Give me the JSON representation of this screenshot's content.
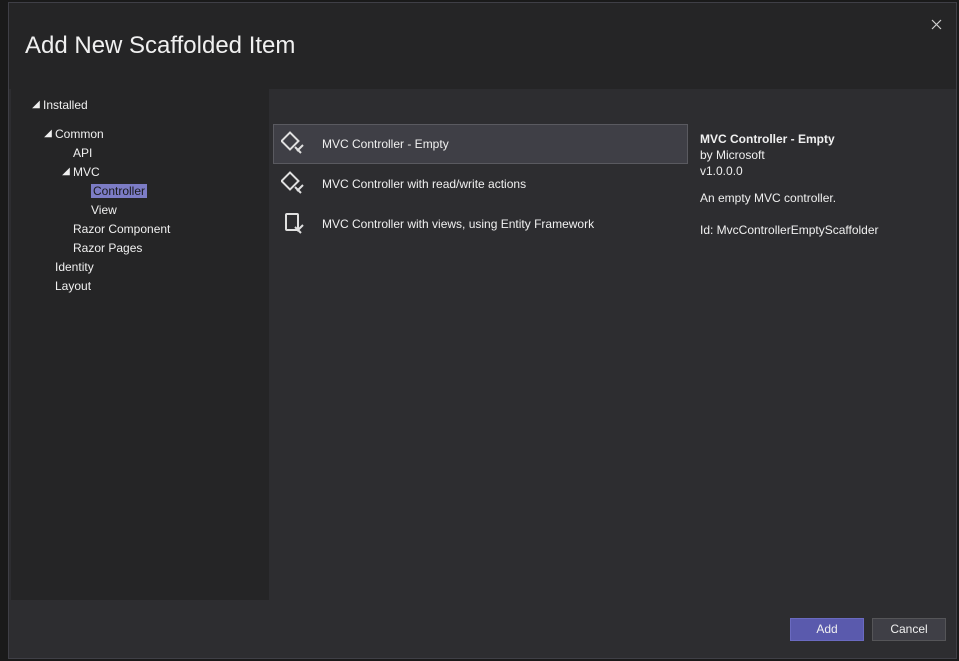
{
  "dialog": {
    "title": "Add New Scaffolded Item"
  },
  "tree": {
    "installed": "Installed",
    "common": "Common",
    "api": "API",
    "mvc": "MVC",
    "controller": "Controller",
    "view": "View",
    "razor_component": "Razor Component",
    "razor_pages": "Razor Pages",
    "identity": "Identity",
    "layout": "Layout"
  },
  "list": {
    "item0": "MVC Controller - Empty",
    "item1": "MVC Controller with read/write actions",
    "item2": "MVC Controller with views, using Entity Framework"
  },
  "details": {
    "title": "MVC Controller - Empty",
    "author": "by Microsoft",
    "version": "v1.0.0.0",
    "description": "An empty MVC controller.",
    "id_line": "Id: MvcControllerEmptyScaffolder"
  },
  "buttons": {
    "add": "Add",
    "cancel": "Cancel"
  }
}
